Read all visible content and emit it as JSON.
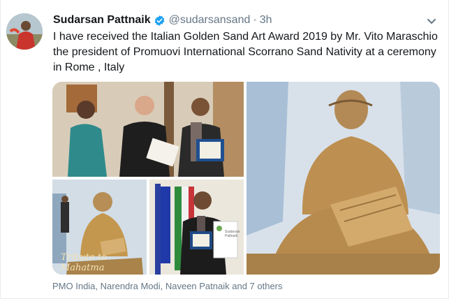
{
  "tweet": {
    "author": {
      "display_name": "Sudarsan Pattnaik",
      "handle": "@sudarsansand",
      "verified": true
    },
    "separator": "·",
    "timestamp": "3h",
    "text": "I have received the Italian Golden Sand Art Award 2019 by Mr. Vito Maraschio the president of Promuovi International Scorrano Sand Nativity at a ceremony in Rome , Italy",
    "media": {
      "photo_count": 4,
      "sand_caption": "Tribute to Mahatma",
      "award_card_header": "Sudarsan Pattnaik"
    },
    "liked_by": "PMO India, Narendra Modi, Naveen Patnaik and 7 others"
  },
  "colors": {
    "text_primary": "#14171a",
    "text_secondary": "#657786",
    "verified_blue": "#1da1f2",
    "border": "#e6ecf0"
  },
  "icons": [
    "verified-badge-icon",
    "chevron-down-icon"
  ]
}
